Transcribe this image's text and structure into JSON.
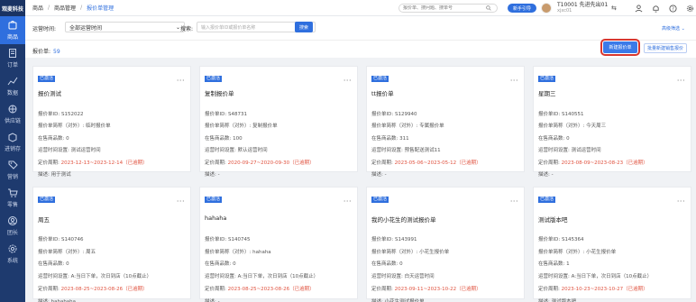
{
  "brand": "观麦科技",
  "sidebar": {
    "items": [
      {
        "label": "商品",
        "icon": "goods-icon"
      },
      {
        "label": "订单",
        "icon": "order-icon"
      },
      {
        "label": "数据",
        "icon": "chart-icon"
      },
      {
        "label": "供应链",
        "icon": "supply-icon"
      },
      {
        "label": "进销存",
        "icon": "inventory-icon"
      },
      {
        "label": "营销",
        "icon": "marketing-icon"
      },
      {
        "label": "零售",
        "icon": "retail-icon"
      },
      {
        "label": "团长",
        "icon": "leader-icon"
      },
      {
        "label": "系统",
        "icon": "settings-icon"
      }
    ]
  },
  "topbar": {
    "breadcrumb": [
      "商品",
      "商品管理",
      "报价单管理"
    ],
    "search_placeholder": "报价单、搜问题、搜单号",
    "new_button": "新手引导",
    "user_name": "T10001 先进先出01",
    "user_sub": "xjxc01"
  },
  "filters": {
    "time_label": "运营时间:",
    "time_value": "全部运营时间",
    "search_label": "搜索:",
    "search_placeholder": "输入报价单ID或报价单名称",
    "search_button": "搜索",
    "advanced": "高级筛选"
  },
  "list": {
    "count_label": "报价单:",
    "count": "59",
    "new_button": "新建报价单",
    "batch_button": "批量新建销售报价"
  },
  "labels": {
    "id": "报价单ID:",
    "alias": "报价单简称（对外）:",
    "on_sale": "在售商品数:",
    "time": "运营时间设置:",
    "price_time": "定价周期:",
    "desc": "描述:"
  },
  "cards": [
    {
      "tag": "已激活",
      "title": "报价测试",
      "id": "S152022",
      "alias": "临时报价单",
      "on_sale": "0",
      "time": "测试运营时间",
      "price_time": "2023-12-13~2023-12-14（已逾期）",
      "desc": "用于测试"
    },
    {
      "tag": "已激活",
      "title": "复制报价单",
      "id": "S48731",
      "alias": "复制报价单",
      "on_sale": "100",
      "time": "默认运营时间",
      "price_time": "2020-09-27~2020-09-30（已逾期）",
      "desc": "-"
    },
    {
      "tag": "已激活",
      "title": "tt报价单",
      "id": "S129940",
      "alias": "专属报价单",
      "on_sale": "311",
      "time": "预售配送测试11",
      "price_time": "2023-05-06~2023-05-12（已逾期）",
      "desc": "-"
    },
    {
      "tag": "已激活",
      "title": "星期三",
      "id": "S140551",
      "alias": "今天周三",
      "on_sale": "0",
      "time": "测试运营时间",
      "price_time": "2023-08-09~2023-08-23（已逾期）",
      "desc": "-"
    },
    {
      "tag": "已激活",
      "title": "周五",
      "id": "S140746",
      "alias": "周五",
      "on_sale": "0",
      "time": "A:当日下单，次日到店（10点截止）",
      "price_time": "2023-08-25~2023-08-26（已逾期）",
      "desc": "hahahaha"
    },
    {
      "tag": "已激活",
      "title": "hahaha",
      "id": "S140745",
      "alias": "hahaha",
      "on_sale": "0",
      "time": "A:当日下单，次日到店（10点截止）",
      "price_time": "2023-08-25~2023-08-26（已逾期）",
      "desc": "-"
    },
    {
      "tag": "已激活",
      "title": "我的小花生的测试报价单",
      "id": "S143991",
      "alias": "小花生报价单",
      "on_sale": "0",
      "time": "白天运营时间",
      "price_time": "2023-09-11~2023-10-22（已逾期）",
      "desc": "小花生测试报价单"
    },
    {
      "tag": "已激活",
      "title": "测试版本吧",
      "id": "S145364",
      "alias": "小花生报价单",
      "on_sale": "1",
      "time": "A:当日下单，次日到店（10点截止）",
      "price_time": "2023-10-23~2023-10-27（已逾期）",
      "desc": "测试版本吧"
    }
  ]
}
